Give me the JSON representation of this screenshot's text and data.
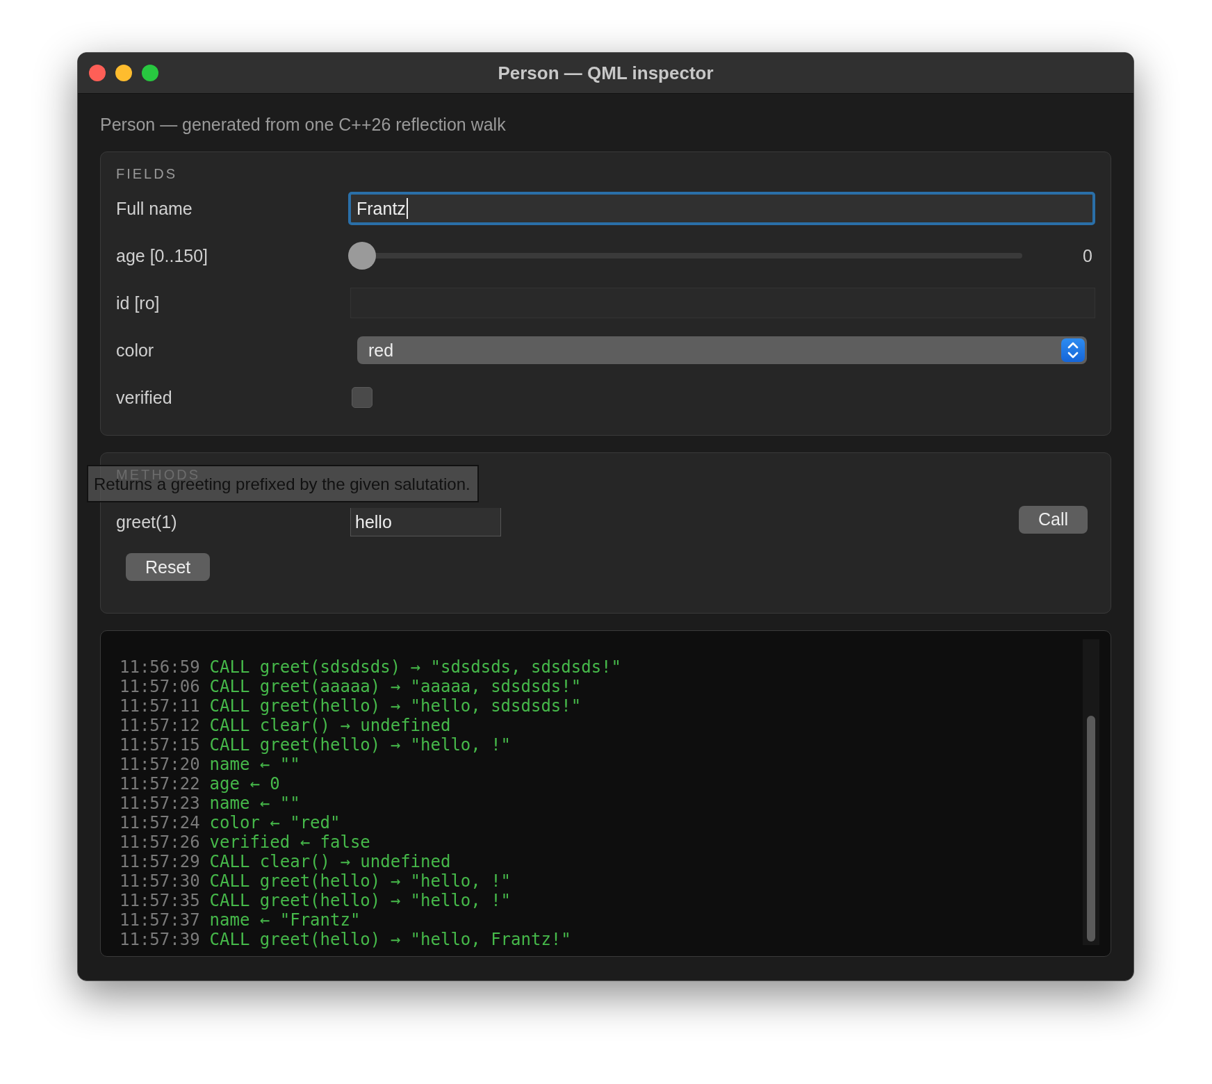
{
  "window": {
    "title": "Person — QML inspector"
  },
  "subtitle": "Person — generated from one C++26 reflection walk",
  "fields": {
    "heading": "FIELDS",
    "rows": [
      {
        "kind": "text",
        "label": "Full name",
        "value": "Frantz",
        "focused": true
      },
      {
        "kind": "slider",
        "label": "age [0..150]",
        "level": 0,
        "reading": "0"
      },
      {
        "kind": "readonly",
        "label": "id [ro]"
      },
      {
        "kind": "select",
        "label": "color",
        "value": "red"
      },
      {
        "kind": "checkbox",
        "label": "verified",
        "checked": false
      }
    ]
  },
  "methods": {
    "heading": "METHODS",
    "tooltip": "Returns a greeting prefixed by the given salutation.",
    "rows": [
      {
        "label": "greet(1)",
        "value": "hello",
        "button": "Call"
      }
    ],
    "reset": "Reset"
  },
  "log": [
    {
      "time": "11:56:59",
      "text": "CALL greet(sdsdsds) → \"sdsdsds, sdsdsds!\""
    },
    {
      "time": "11:57:06",
      "text": "CALL greet(aaaaa) → \"aaaaa, sdsdsds!\""
    },
    {
      "time": "11:57:11",
      "text": "CALL greet(hello) → \"hello, sdsdsds!\""
    },
    {
      "time": "11:57:12",
      "text": "CALL clear() → undefined"
    },
    {
      "time": "11:57:15",
      "text": "CALL greet(hello) → \"hello, !\""
    },
    {
      "time": "11:57:20",
      "text": "name ← \"\""
    },
    {
      "time": "11:57:22",
      "text": "age ← 0"
    },
    {
      "time": "11:57:23",
      "text": "name ← \"\""
    },
    {
      "time": "11:57:24",
      "text": "color ← \"red\""
    },
    {
      "time": "11:57:26",
      "text": "verified ← false"
    },
    {
      "time": "11:57:29",
      "text": "CALL clear() → undefined"
    },
    {
      "time": "11:57:30",
      "text": "CALL greet(hello) → \"hello, !\""
    },
    {
      "time": "11:57:35",
      "text": "CALL greet(hello) → \"hello, !\""
    },
    {
      "time": "11:57:37",
      "text": "name ← \"Frantz\""
    },
    {
      "time": "11:57:39",
      "text": "CALL greet(hello) → \"hello, Frantz!\""
    }
  ]
}
